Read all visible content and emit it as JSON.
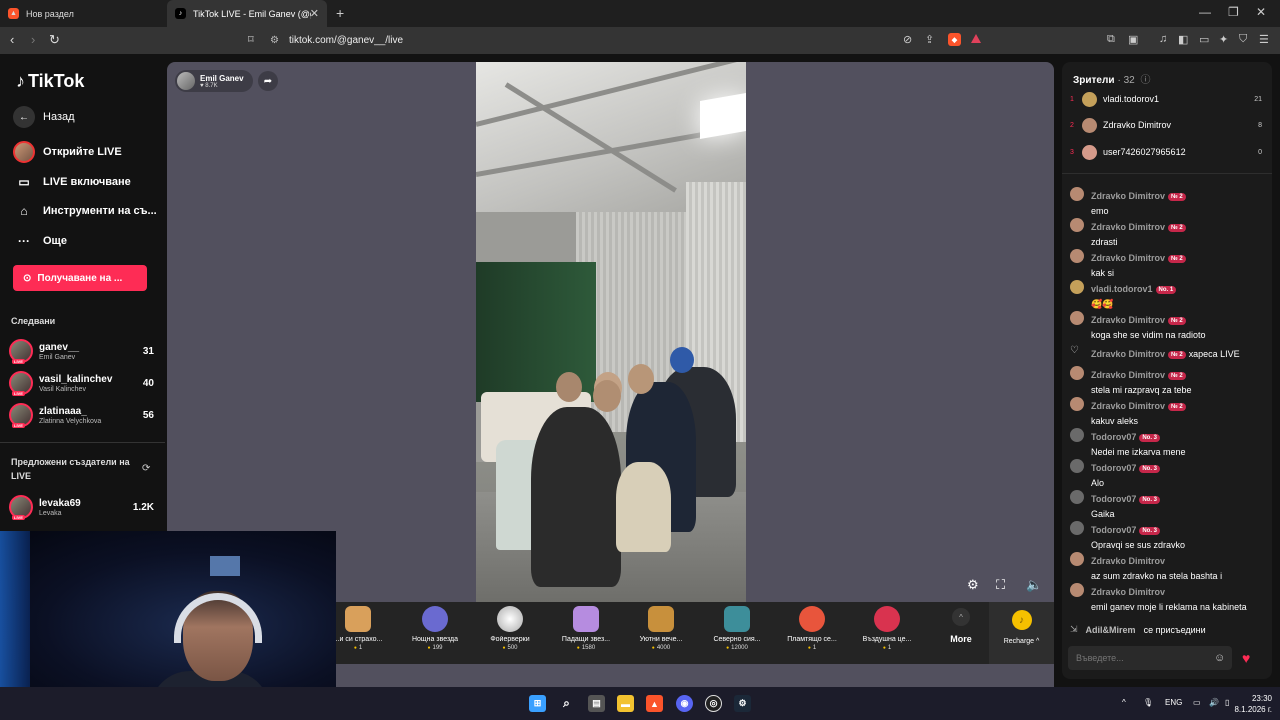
{
  "browser": {
    "tabs": [
      {
        "title": "Нов раздел",
        "active": false
      },
      {
        "title": "TikTok LIVE - Emil Ganev (@g",
        "active": true
      }
    ],
    "new_tab": "+",
    "url": "tiktok.com/@ganev__/live"
  },
  "sidebar": {
    "logo": "TikTok",
    "back": "Назад",
    "nav": [
      {
        "label": "Открийте LIVE",
        "icon": "avatar-icon"
      },
      {
        "label": "LIVE включване",
        "icon": "camera-icon"
      },
      {
        "label": "Инструменти на съ...",
        "icon": "home-icon"
      },
      {
        "label": "Още",
        "icon": "more-icon"
      }
    ],
    "cta": "Получаване на ...",
    "following_title": "Следвани",
    "following": [
      {
        "user": "ganev__",
        "name": "Emil Ganev",
        "count": "31"
      },
      {
        "user": "vasil_kalinchev",
        "name": "Vasil Kalinchev",
        "count": "40"
      },
      {
        "user": "zlatinaaa_",
        "name": "Zlatinna Velychkova",
        "count": "56"
      }
    ],
    "suggested_title": "Предложени създатели на LIVE",
    "suggested": [
      {
        "user": "levaka69",
        "name": "Levaka",
        "count": "1.2K"
      }
    ],
    "live_tag": "LIVE"
  },
  "stream": {
    "streamer_name": "Emil Ganev",
    "likes": "♥ 8.7K"
  },
  "gifts": [
    {
      "name": "...и си страхо...",
      "price": "1"
    },
    {
      "name": "Нощна звезда",
      "price": "199"
    },
    {
      "name": "Фойерверки",
      "price": "500"
    },
    {
      "name": "Падащи звез...",
      "price": "1580"
    },
    {
      "name": "Уютни вече...",
      "price": "4000"
    },
    {
      "name": "Северно сия...",
      "price": "12000"
    },
    {
      "name": "Пламтящо се...",
      "price": "1"
    },
    {
      "name": "Въздушна це...",
      "price": "1"
    }
  ],
  "gift_more": "More",
  "recharge": "Recharge ^",
  "viewers": {
    "title": "Зрители",
    "count": "· 32",
    "ranking": [
      {
        "rank": "1",
        "name": "vladi.todorov1",
        "score": "21"
      },
      {
        "rank": "2",
        "name": "Zdravko Dimitrov",
        "score": "8"
      },
      {
        "rank": "3",
        "name": "user7426027965612",
        "score": "0"
      }
    ]
  },
  "chat": [
    {
      "user": "Zdravko Dimitrov",
      "badge": "№ 2",
      "text": "emo"
    },
    {
      "user": "Zdravko Dimitrov",
      "badge": "№ 2",
      "text": "zdrasti"
    },
    {
      "user": "Zdravko Dimitrov",
      "badge": "№ 2",
      "text": "kak si"
    },
    {
      "user": "vladi.todorov1",
      "badge": "No. 1",
      "text": "🥰🥰"
    },
    {
      "user": "Zdravko Dimitrov",
      "badge": "№ 2",
      "text": "koga she se vidim na radioto"
    },
    {
      "user": "Zdravko Dimitrov",
      "badge": "№ 2",
      "inline": "хареса LIVE"
    },
    {
      "user": "Zdravko Dimitrov",
      "badge": "№ 2",
      "text": "stela mi razpravq za tebe"
    },
    {
      "user": "Zdravko Dimitrov",
      "badge": "№ 2",
      "text": "kakuv aleks"
    },
    {
      "user": "Todorov07",
      "badge": "No. 3",
      "text": "Nedei me izkarva mene"
    },
    {
      "user": "Todorov07",
      "badge": "No. 3",
      "text": "Alo"
    },
    {
      "user": "Todorov07",
      "badge": "No. 3",
      "text": "Gaika"
    },
    {
      "user": "Todorov07",
      "badge": "No. 3",
      "text": "Opravqi se sus zdravko"
    },
    {
      "user": "Zdravko Dimitrov",
      "badge": "",
      "text": "az sum zdravko na stela bashta i"
    },
    {
      "user": "Zdravko Dimitrov",
      "badge": "",
      "text": "emil ganev moje li reklama na kabineta"
    }
  ],
  "join_notice": {
    "user": "Adil&Mirem",
    "text": "се присъедини"
  },
  "chat_input_placeholder": "Въведете...",
  "taskbar": {
    "lang": "ENG",
    "time": "23:30",
    "date": "8.1.2026 г."
  },
  "colors": {
    "accent": "#fe2c55",
    "video_bg": "#52505e",
    "panel_bg": "#1b1b1b"
  }
}
